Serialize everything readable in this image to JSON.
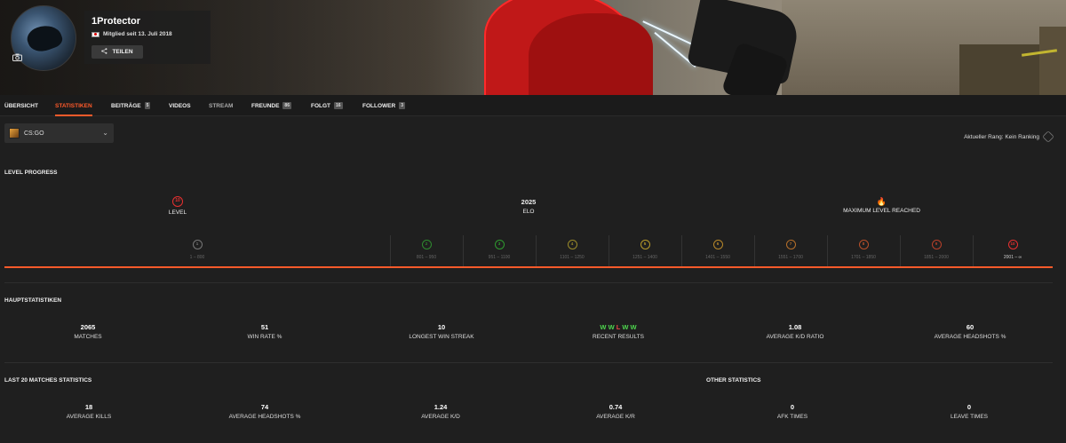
{
  "profile": {
    "nickname": "1Protector",
    "member_since": "Mitglied seit 13. Juli 2018",
    "share_label": "TEILEN"
  },
  "tabs": [
    {
      "label": "ÜBERSICHT",
      "badge": null
    },
    {
      "label": "STATISTIKEN",
      "badge": null,
      "active": true
    },
    {
      "label": "BEITRÄGE",
      "badge": "5"
    },
    {
      "label": "VIDEOS",
      "badge": null
    },
    {
      "label": "STREAM",
      "badge": null
    },
    {
      "label": "FREUNDE",
      "badge": "86"
    },
    {
      "label": "FOLGT",
      "badge": "16"
    },
    {
      "label": "FOLLOWER",
      "badge": "3"
    }
  ],
  "game": {
    "selected": "CS:GO"
  },
  "rank": {
    "label": "Aktueller Rang: Kein Ranking"
  },
  "level_progress": {
    "title": "LEVEL PROGRESS",
    "level_label": "LEVEL",
    "level_value": "10",
    "elo_value": "2025",
    "elo_label": "ELO",
    "max_label": "MAXIMUM LEVEL REACHED",
    "segments": [
      {
        "level": "1",
        "range": "1 – 800",
        "color": "#777777"
      },
      {
        "level": "2",
        "range": "801 – 950",
        "color": "#2f8a2f"
      },
      {
        "level": "3",
        "range": "951 – 1100",
        "color": "#2f9a2f"
      },
      {
        "level": "4",
        "range": "1101 – 1250",
        "color": "#9a8a2a"
      },
      {
        "level": "5",
        "range": "1251 – 1400",
        "color": "#b89a2a"
      },
      {
        "level": "6",
        "range": "1401 – 1550",
        "color": "#b8882a"
      },
      {
        "level": "7",
        "range": "1551 – 1700",
        "color": "#b8702a"
      },
      {
        "level": "8",
        "range": "1701 – 1850",
        "color": "#b8502a"
      },
      {
        "level": "9",
        "range": "1851 – 2000",
        "color": "#b8402a"
      },
      {
        "level": "10",
        "range": "2001 – ∞",
        "color": "#e83030"
      }
    ]
  },
  "main_stats": {
    "title": "HAUPTSTATISTIKEN",
    "matches": {
      "value": "2065",
      "label": "MATCHES"
    },
    "win_rate": {
      "value": "51",
      "label": "WIN RATE %"
    },
    "longest_streak": {
      "value": "10",
      "label": "LONGEST WIN STREAK"
    },
    "recent_results": {
      "results": [
        "W",
        "W",
        "L",
        "W",
        "W"
      ],
      "label": "RECENT RESULTS"
    },
    "avg_kd": {
      "value": "1.08",
      "label": "AVERAGE K/D RATIO"
    },
    "avg_hs": {
      "value": "60",
      "label": "AVERAGE HEADSHOTS %"
    }
  },
  "last20": {
    "title": "LAST 20 MATCHES STATISTICS",
    "other_title": "OTHER STATISTICS",
    "avg_kills": {
      "value": "18",
      "label": "AVERAGE KILLS"
    },
    "avg_hs": {
      "value": "74",
      "label": "AVERAGE HEADSHOTS %"
    },
    "avg_kd": {
      "value": "1.24",
      "label": "AVERAGE K/D"
    },
    "avg_kr": {
      "value": "0.74",
      "label": "AVERAGE K/R"
    },
    "afk": {
      "value": "0",
      "label": "AFK TIMES"
    },
    "leave": {
      "value": "0",
      "label": "LEAVE TIMES"
    }
  },
  "colors": {
    "accent": "#ff5a2a",
    "win": "#4ed64e",
    "loss": "#e84545"
  }
}
